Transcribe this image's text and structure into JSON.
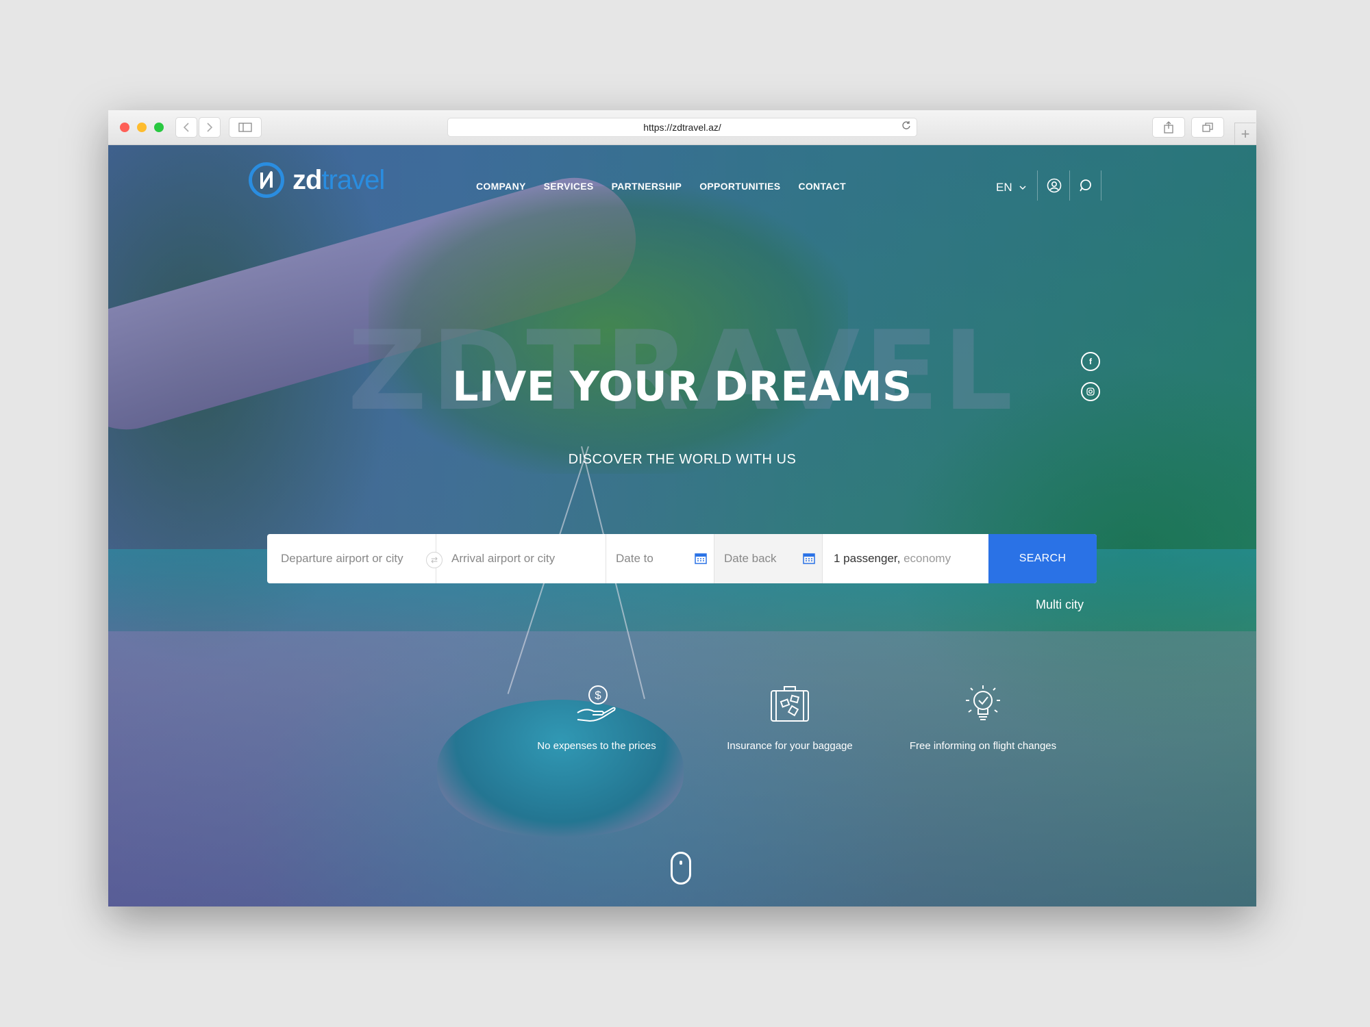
{
  "browser": {
    "url": "https://zdtravel.az/",
    "back_icon": "chevron-left-icon",
    "forward_icon": "chevron-right-icon",
    "sidebar_icon": "sidebar-icon",
    "share_icon": "share-icon",
    "tabs_icon": "tabs-icon",
    "reload_icon": "reload-icon",
    "new_tab_symbol": "+"
  },
  "header": {
    "logo_prefix": "zd",
    "logo_suffix": "travel",
    "nav": [
      "COMPANY",
      "SERVICES",
      "PARTNERSHIP",
      "OPPORTUNITIES",
      "CONTACT"
    ],
    "language": "EN",
    "account_icon": "user-icon",
    "search_icon": "search-icon"
  },
  "hero": {
    "ghost_text": "ZDTRAVEL",
    "title": "LIVE YOUR DREAMS",
    "subtitle": "DISCOVER THE WORLD WITH US"
  },
  "social": {
    "facebook": "f",
    "instagram_icon": "instagram-icon"
  },
  "search": {
    "departure_placeholder": "Departure airport or city",
    "arrival_placeholder": "Arrival airport or city",
    "date_to": "Date to",
    "date_back": "Date back",
    "passengers": "1 passenger,",
    "cabin": "economy",
    "button": "SEARCH",
    "multi_city": "Multi city"
  },
  "features": [
    {
      "icon": "money-hand-icon",
      "label": "No expenses to the prices"
    },
    {
      "icon": "baggage-icon",
      "label": "Insurance for your baggage"
    },
    {
      "icon": "lightbulb-icon",
      "label": "Free informing on flight changes"
    }
  ],
  "colors": {
    "accent": "#2a72e6",
    "logo_blue": "#2a8de0"
  }
}
